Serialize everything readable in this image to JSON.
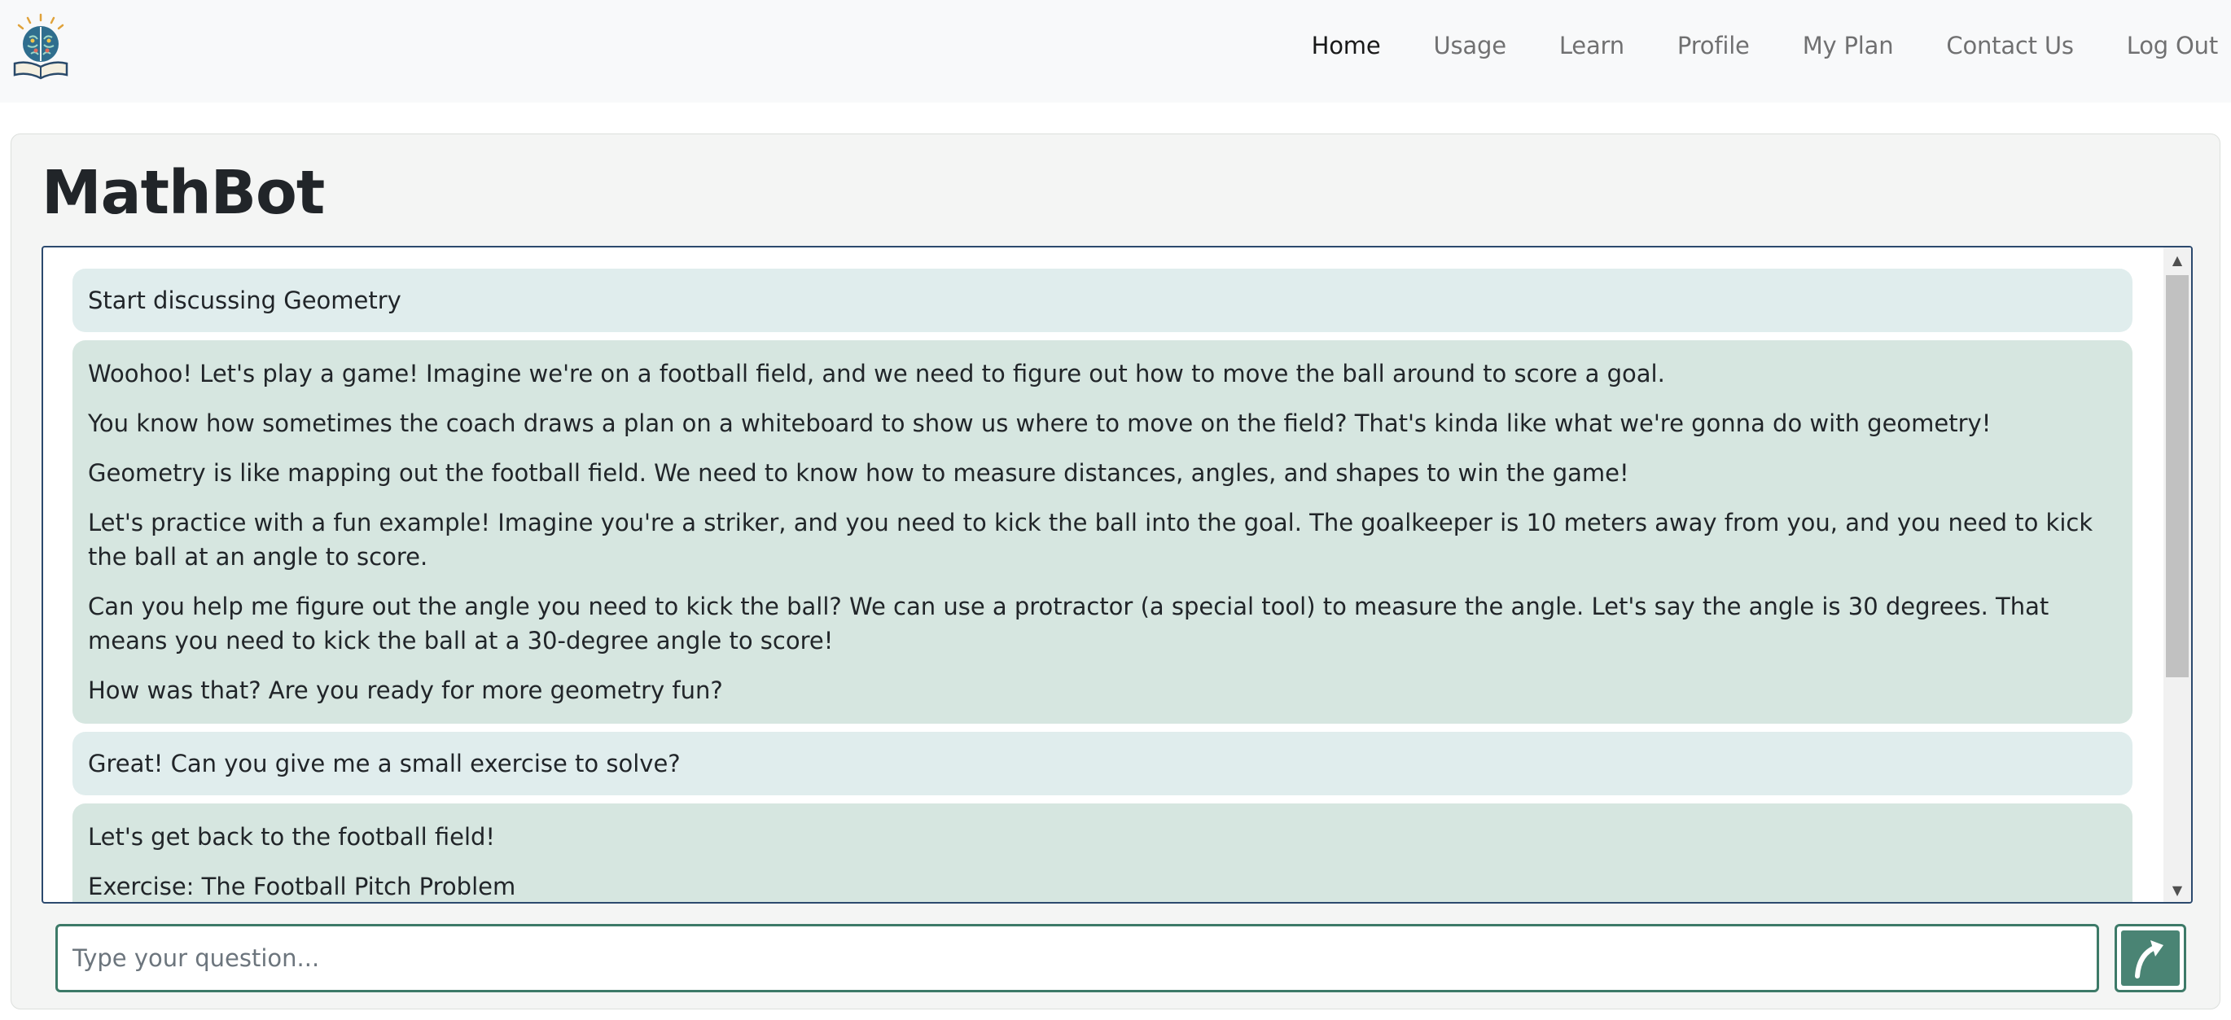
{
  "app": {
    "logo_icon": "brain-book-logo-icon"
  },
  "nav": {
    "items": [
      {
        "label": "Home",
        "active": true
      },
      {
        "label": "Usage",
        "active": false
      },
      {
        "label": "Learn",
        "active": false
      },
      {
        "label": "Profile",
        "active": false
      },
      {
        "label": "My Plan",
        "active": false
      },
      {
        "label": "Contact Us",
        "active": false
      },
      {
        "label": "Log Out",
        "active": false
      }
    ]
  },
  "page": {
    "title": "MathBot"
  },
  "chat": {
    "messages": [
      {
        "role": "user",
        "paragraphs": [
          "Start discussing Geometry"
        ]
      },
      {
        "role": "bot",
        "paragraphs": [
          "Woohoo! Let's play a game! Imagine we're on a football field, and we need to figure out how to move the ball around to score a goal.",
          "You know how sometimes the coach draws a plan on a whiteboard to show us where to move on the field? That's kinda like what we're gonna do with geometry!",
          "Geometry is like mapping out the football field. We need to know how to measure distances, angles, and shapes to win the game!",
          "Let's practice with a fun example! Imagine you're a striker, and you need to kick the ball into the goal. The goalkeeper is 10 meters away from you, and you need to kick the ball at an angle to score.",
          "Can you help me figure out the angle you need to kick the ball? We can use a protractor (a special tool) to measure the angle. Let's say the angle is 30 degrees. That means you need to kick the ball at a 30-degree angle to score!",
          "How was that? Are you ready for more geometry fun?"
        ]
      },
      {
        "role": "user",
        "paragraphs": [
          "Great! Can you give me a small exercise to solve?"
        ]
      },
      {
        "role": "bot",
        "paragraphs": [
          "Let's get back to the football field!",
          "Exercise: The Football Pitch Problem"
        ]
      }
    ]
  },
  "input": {
    "placeholder": "Type your question...",
    "value": ""
  },
  "send_button": {
    "icon": "curved-arrow-up-icon"
  },
  "colors": {
    "accent": "#3d7a68",
    "chat_border": "#2c4a6e",
    "user_bubble": "#e0eded",
    "bot_bubble": "#d6e6e0"
  }
}
